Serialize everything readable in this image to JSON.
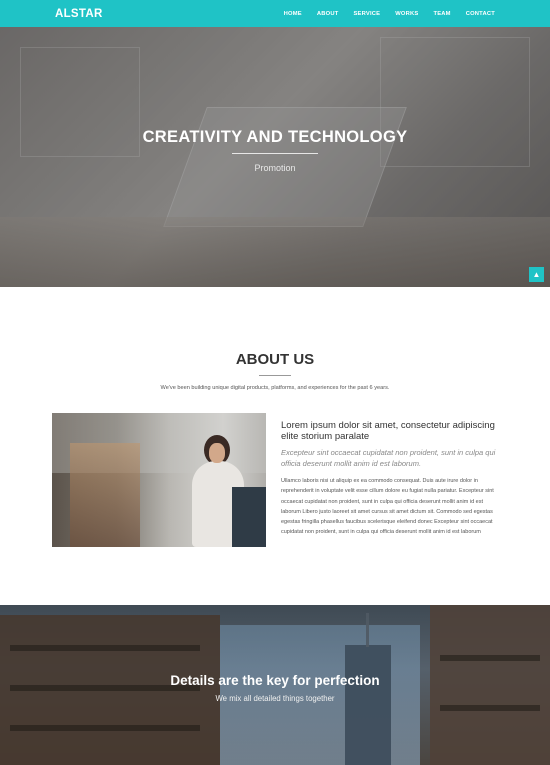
{
  "nav": {
    "brand": "ALSTAR",
    "items": [
      "HOME",
      "ABOUT",
      "SERVICE",
      "WORKS",
      "TEAM",
      "CONTACT"
    ]
  },
  "hero": {
    "title": "CREATIVITY AND TECHNOLOGY",
    "subtitle": "Promotion",
    "scroll_top_icon": "chevron-up-icon"
  },
  "about": {
    "title": "ABOUT US",
    "subtitle": "We've been building unique digital products, platforms, and experiences for the past 6 years.",
    "heading": "Lorem ipsum dolor sit amet, consectetur adipiscing elite storium paralate",
    "quote": "Excepteur sint occaecat cupidatat non proident, sunt in culpa qui officia deserunt mollit anim id est laborum.",
    "body": "Ullamco laboris nisi ut aliquip ex ea commodo consequat. Duis aute irure dolor in reprehenderit in voluptate velit esse cillum dolore eu fugiat nulla pariatur. Excepteur sint occaecat cupidatat non proident, sunt in culpa qui officia deserunt mollit anim id est laborum Libero justo laoreet sit amet cursus sit amet dictum sit. Commodo sed egestas egestas fringilla phasellus faucibus scelerisque eleifend donec Excepteur sint occaecat cupidatat non proident, sunt in culpa qui officia deserunt mollit anim id est laborum"
  },
  "details": {
    "title": "Details are the key for perfection",
    "subtitle": "We mix all detailed things together"
  },
  "colors": {
    "accent": "#1fc3c6"
  }
}
